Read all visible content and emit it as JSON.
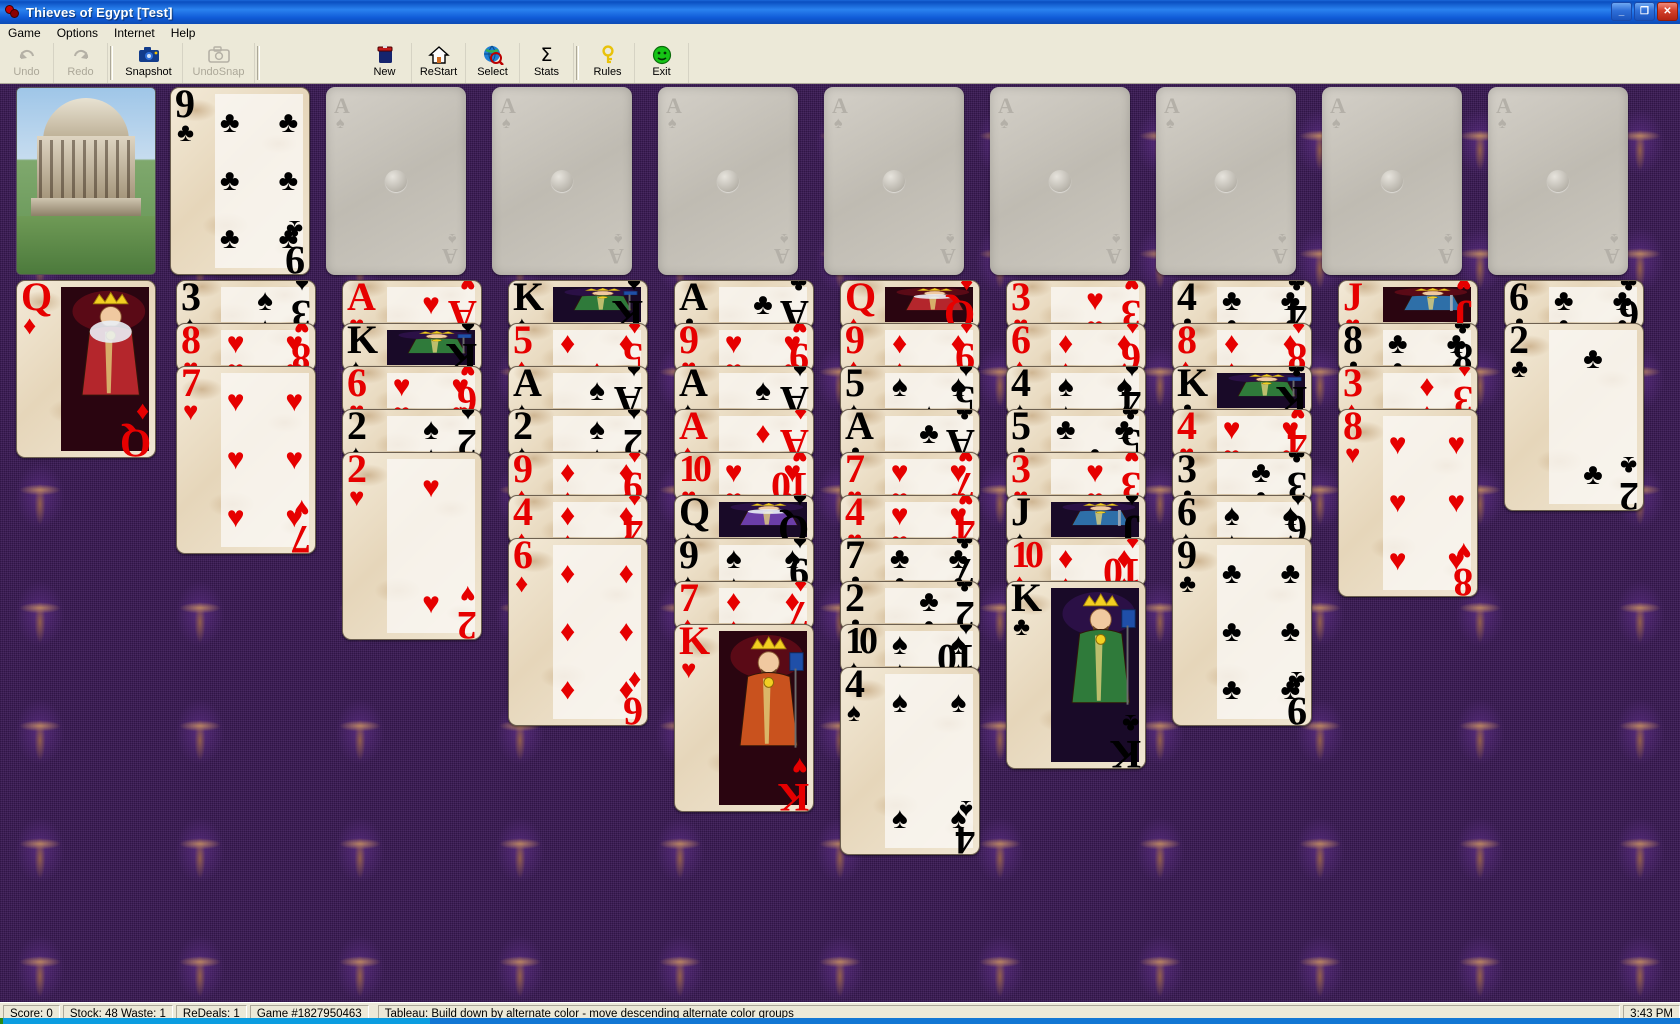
{
  "window": {
    "title": "Thieves of Egypt [Test]",
    "icon": "cards-icon",
    "buttons": {
      "minimize": "_",
      "maximize": "❐",
      "close": "✕"
    }
  },
  "menubar": {
    "items": [
      {
        "label": "Game",
        "accel": "G"
      },
      {
        "label": "Options",
        "accel": "O"
      },
      {
        "label": "Internet",
        "accel": "I"
      },
      {
        "label": "Help",
        "accel": "H"
      }
    ]
  },
  "toolbar": {
    "buttons": [
      {
        "label": "Undo",
        "icon": "undo-icon",
        "enabled": false
      },
      {
        "label": "Redo",
        "icon": "redo-icon",
        "enabled": false
      },
      {
        "label": "Snapshot",
        "icon": "camera-icon",
        "enabled": true
      },
      {
        "label": "UndoSnap",
        "icon": "undo-snap-icon",
        "enabled": false
      },
      {
        "label": "New",
        "icon": "cards-deck-icon",
        "enabled": true
      },
      {
        "label": "ReStart",
        "icon": "house-icon",
        "enabled": true
      },
      {
        "label": "Select",
        "icon": "globe-icon",
        "enabled": true
      },
      {
        "label": "Stats",
        "icon": "sigma-icon",
        "enabled": true
      },
      {
        "label": "Rules",
        "icon": "key-icon",
        "enabled": true
      },
      {
        "label": "Exit",
        "icon": "smiley-icon",
        "enabled": true
      }
    ]
  },
  "statusbar": {
    "score": "Score:  0",
    "stock_waste": "Stock: 48   Waste: 1",
    "redeals": "ReDeals: 1",
    "game_number": "Game #1827950463",
    "hint": "Tableau: Build down by alternate color - move descending alternate color groups",
    "time": "3:43 PM"
  },
  "board": {
    "photo_tile": {
      "name": "radcliffe-camera-photo"
    },
    "stock_card": {
      "rank": "9",
      "suit": "clubs",
      "color": "black"
    },
    "foundations": [
      {
        "ghost_rank": "A",
        "ghost_suit": "spades"
      },
      {
        "ghost_rank": "A",
        "ghost_suit": "spades"
      },
      {
        "ghost_rank": "A",
        "ghost_suit": "spades"
      },
      {
        "ghost_rank": "A",
        "ghost_suit": "spades"
      },
      {
        "ghost_rank": "A",
        "ghost_suit": "spades"
      },
      {
        "ghost_rank": "A",
        "ghost_suit": "spades"
      },
      {
        "ghost_rank": "A",
        "ghost_suit": "spades"
      },
      {
        "ghost_rank": "A",
        "ghost_suit": "spades"
      }
    ],
    "free_cell": {
      "rank": "Q",
      "suit": "diamonds",
      "color": "red",
      "is_face": true
    },
    "tableau": [
      {
        "name": "tableau-column-1",
        "cards": [
          {
            "rank": "3",
            "suit": "spades",
            "color": "black"
          },
          {
            "rank": "8",
            "suit": "hearts",
            "color": "red"
          },
          {
            "rank": "7",
            "suit": "hearts",
            "color": "red"
          }
        ]
      },
      {
        "name": "tableau-column-2",
        "cards": [
          {
            "rank": "A",
            "suit": "hearts",
            "color": "red"
          },
          {
            "rank": "K",
            "suit": "spades",
            "color": "black",
            "is_face": true
          },
          {
            "rank": "6",
            "suit": "hearts",
            "color": "red"
          },
          {
            "rank": "2",
            "suit": "spades",
            "color": "black"
          },
          {
            "rank": "2",
            "suit": "hearts",
            "color": "red"
          }
        ]
      },
      {
        "name": "tableau-column-3",
        "cards": [
          {
            "rank": "K",
            "suit": "spades",
            "color": "black",
            "is_face": true
          },
          {
            "rank": "5",
            "suit": "diamonds",
            "color": "red"
          },
          {
            "rank": "A",
            "suit": "spades",
            "color": "black"
          },
          {
            "rank": "2",
            "suit": "spades",
            "color": "black"
          },
          {
            "rank": "9",
            "suit": "diamonds",
            "color": "red"
          },
          {
            "rank": "4",
            "suit": "diamonds",
            "color": "red"
          },
          {
            "rank": "6",
            "suit": "diamonds",
            "color": "red"
          }
        ]
      },
      {
        "name": "tableau-column-4",
        "cards": [
          {
            "rank": "A",
            "suit": "clubs",
            "color": "black"
          },
          {
            "rank": "9",
            "suit": "hearts",
            "color": "red"
          },
          {
            "rank": "A",
            "suit": "spades",
            "color": "black"
          },
          {
            "rank": "A",
            "suit": "diamonds",
            "color": "red"
          },
          {
            "rank": "10",
            "suit": "hearts",
            "color": "red"
          },
          {
            "rank": "Q",
            "suit": "spades",
            "color": "black",
            "is_face": true
          },
          {
            "rank": "9",
            "suit": "spades",
            "color": "black"
          },
          {
            "rank": "7",
            "suit": "diamonds",
            "color": "red"
          },
          {
            "rank": "K",
            "suit": "hearts",
            "color": "red",
            "is_face": true
          }
        ]
      },
      {
        "name": "tableau-column-5",
        "cards": [
          {
            "rank": "Q",
            "suit": "diamonds",
            "color": "red",
            "is_face": true
          },
          {
            "rank": "9",
            "suit": "diamonds",
            "color": "red"
          },
          {
            "rank": "5",
            "suit": "spades",
            "color": "black"
          },
          {
            "rank": "A",
            "suit": "clubs",
            "color": "black"
          },
          {
            "rank": "7",
            "suit": "hearts",
            "color": "red"
          },
          {
            "rank": "4",
            "suit": "hearts",
            "color": "red"
          },
          {
            "rank": "7",
            "suit": "clubs",
            "color": "black"
          },
          {
            "rank": "2",
            "suit": "clubs",
            "color": "black"
          },
          {
            "rank": "10",
            "suit": "spades",
            "color": "black"
          },
          {
            "rank": "4",
            "suit": "spades",
            "color": "black"
          }
        ]
      },
      {
        "name": "tableau-column-6",
        "cards": [
          {
            "rank": "3",
            "suit": "hearts",
            "color": "red"
          },
          {
            "rank": "6",
            "suit": "diamonds",
            "color": "red"
          },
          {
            "rank": "4",
            "suit": "spades",
            "color": "black"
          },
          {
            "rank": "5",
            "suit": "clubs",
            "color": "black"
          },
          {
            "rank": "3",
            "suit": "hearts",
            "color": "red"
          },
          {
            "rank": "J",
            "suit": "spades",
            "color": "black",
            "is_face": true
          },
          {
            "rank": "10",
            "suit": "diamonds",
            "color": "red"
          },
          {
            "rank": "K",
            "suit": "clubs",
            "color": "black",
            "is_face": true
          }
        ]
      },
      {
        "name": "tableau-column-7",
        "cards": [
          {
            "rank": "4",
            "suit": "clubs",
            "color": "black"
          },
          {
            "rank": "8",
            "suit": "diamonds",
            "color": "red"
          },
          {
            "rank": "K",
            "suit": "clubs",
            "color": "black",
            "is_face": true
          },
          {
            "rank": "4",
            "suit": "hearts",
            "color": "red"
          },
          {
            "rank": "3",
            "suit": "clubs",
            "color": "black"
          },
          {
            "rank": "6",
            "suit": "spades",
            "color": "black"
          },
          {
            "rank": "9",
            "suit": "clubs",
            "color": "black"
          }
        ]
      },
      {
        "name": "tableau-column-8",
        "cards": [
          {
            "rank": "J",
            "suit": "hearts",
            "color": "red",
            "is_face": true
          },
          {
            "rank": "8",
            "suit": "clubs",
            "color": "black"
          },
          {
            "rank": "3",
            "suit": "diamonds",
            "color": "red"
          },
          {
            "rank": "8",
            "suit": "hearts",
            "color": "red"
          }
        ]
      },
      {
        "name": "tableau-column-9",
        "cards": [
          {
            "rank": "6",
            "suit": "clubs",
            "color": "black"
          },
          {
            "rank": "2",
            "suit": "clubs",
            "color": "black"
          }
        ]
      }
    ]
  },
  "colors": {
    "titlebar_blue": "#0a4fc0",
    "felt_purple": "#3c1b57",
    "chrome": "#ece9d8",
    "red_suit": "#e60000",
    "black_suit": "#000000"
  }
}
